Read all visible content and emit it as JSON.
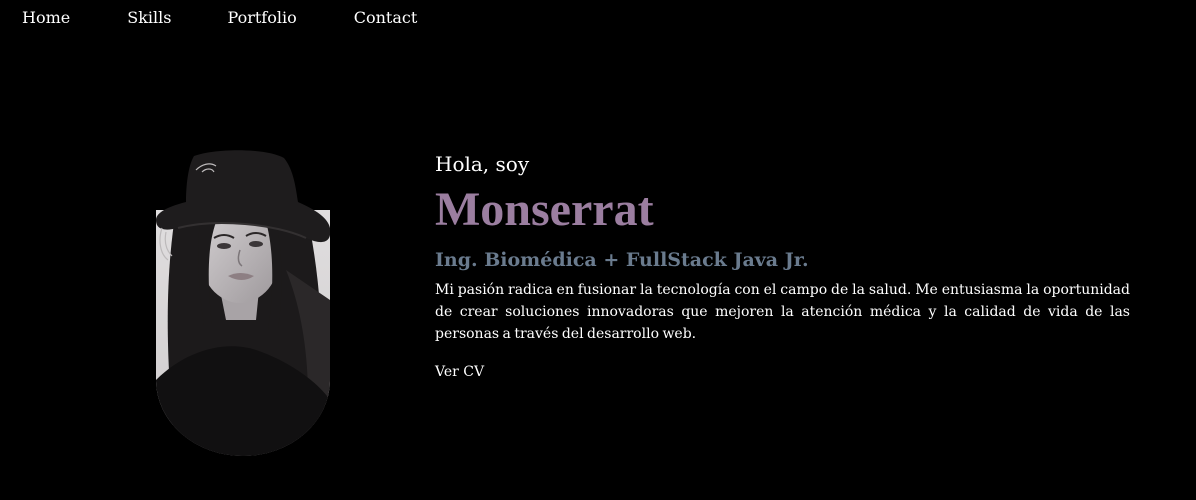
{
  "nav": {
    "items": [
      {
        "label": "Home"
      },
      {
        "label": "Skills"
      },
      {
        "label": "Portfolio"
      },
      {
        "label": "Contact"
      }
    ]
  },
  "hero": {
    "greeting": "Hola, soy",
    "name": "Monserrat",
    "role": "Ing. Biomédica + FullStack Java Jr.",
    "description": "Mi pasión radica en fusionar la tecnología con el campo de la salud. Me entusiasma la oportunidad de crear soluciones innovadoras que mejoren la atención médica y la calidad de vida de las personas a través del desarrollo web.",
    "cv_link": "Ver CV"
  },
  "colors": {
    "background": "#000000",
    "name_accent": "#9b7ea0",
    "role_accent": "#6a7b8e",
    "text": "#ffffff"
  }
}
